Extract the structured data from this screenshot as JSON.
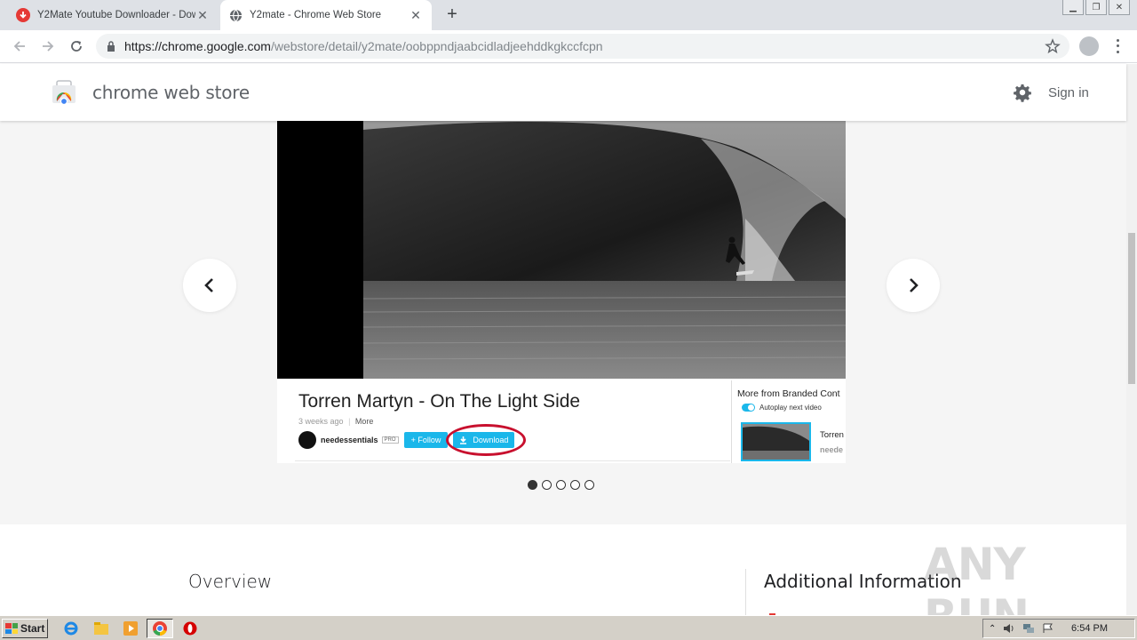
{
  "browser": {
    "tabs": [
      {
        "title": "Y2Mate Youtube Downloader - Down",
        "icon": "y2mate-favicon",
        "active": false
      },
      {
        "title": "Y2mate - Chrome Web Store",
        "icon": "globe-icon",
        "active": true
      }
    ],
    "url_host": "https://chrome.google.com",
    "url_path": "/webstore/detail/y2mate/oobppndjaabcidladjeehddkgkccfcpn"
  },
  "store": {
    "title": "chrome web store",
    "sign_in": "Sign in"
  },
  "slide": {
    "video_title": "Torren Martyn - On The Light Side",
    "posted": "3 weeks ago",
    "more": "More",
    "channel": "needessentials",
    "pro": "PRO",
    "follow": "+ Follow",
    "download": "Download",
    "related_heading": "More from Branded Cont",
    "autoplay": "Autoplay next video",
    "related_title": "Torren",
    "related_channel": "neede",
    "dots_total": 5,
    "dots_active": 1
  },
  "sections": {
    "overview": "Overview",
    "additional": "Additional Information"
  },
  "watermark": "ANY RUN",
  "taskbar": {
    "start": "Start",
    "clock": "6:54 PM"
  },
  "colors": {
    "accent_blue": "#1ab7ea",
    "highlight_red": "#c8102e"
  }
}
